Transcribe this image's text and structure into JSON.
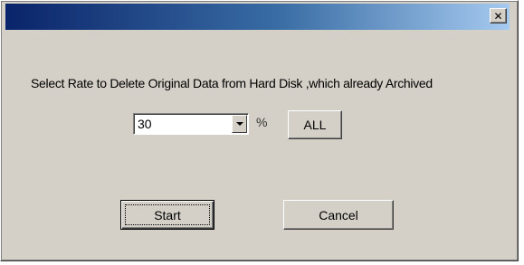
{
  "titlebar": {
    "close_label": "✕"
  },
  "message": "Select Rate to Delete Original Data from Hard Disk ,which already Archived",
  "rate_combo": {
    "selected_value": "30"
  },
  "percent_symbol": "%",
  "buttons": {
    "all_label": "ALL",
    "start_label": "Start",
    "cancel_label": "Cancel"
  }
}
